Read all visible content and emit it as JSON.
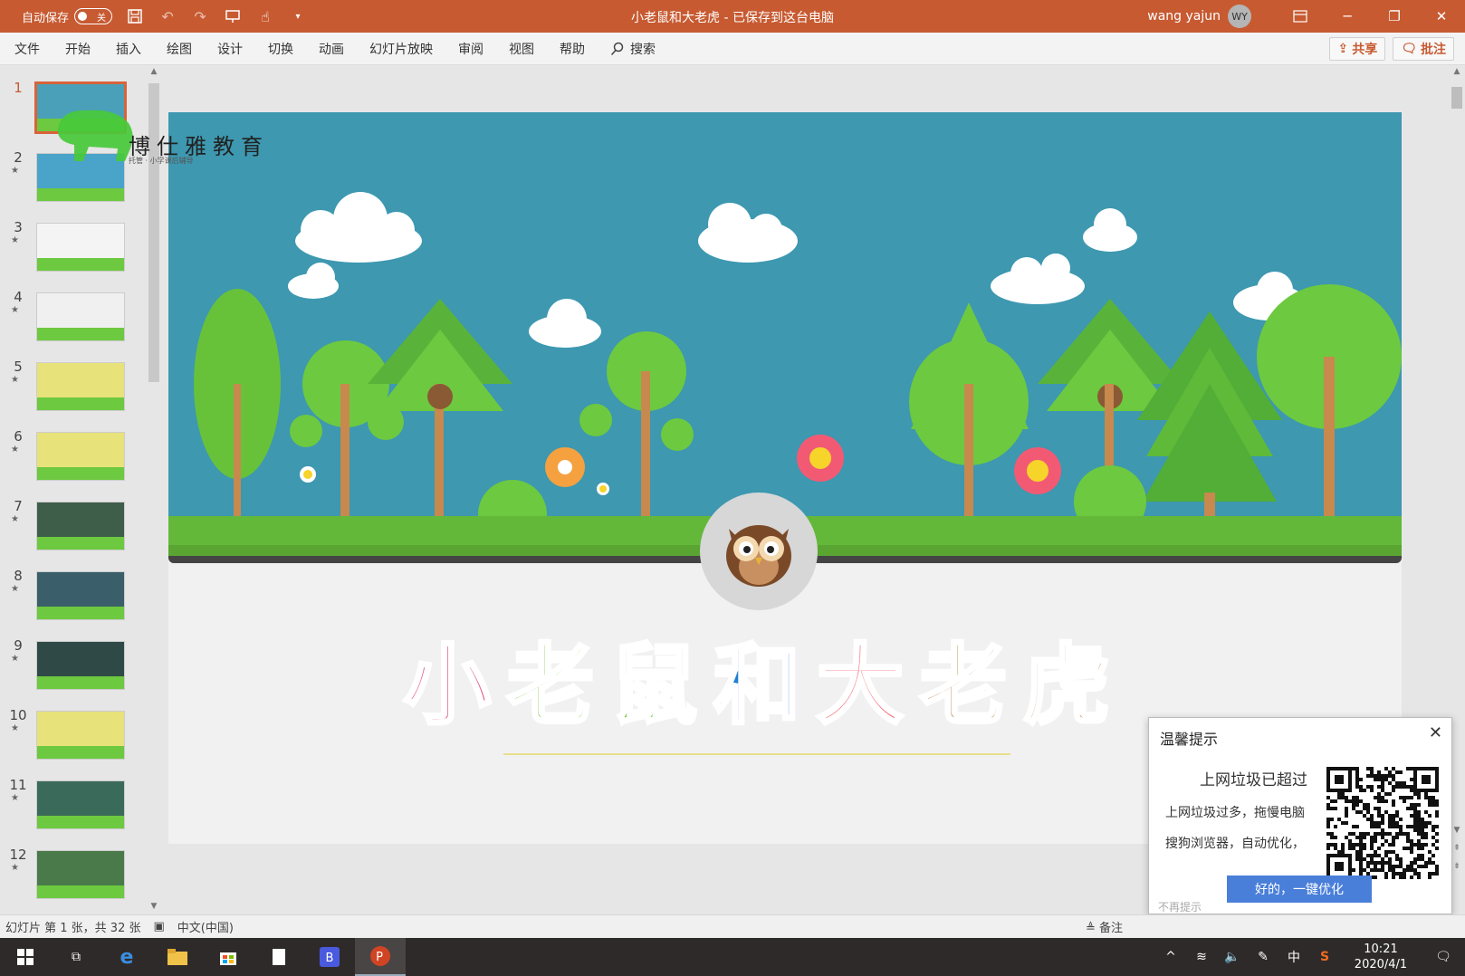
{
  "titlebar": {
    "autosave_label": "自动保存",
    "autosave_state": "关",
    "doc_title": "小老鼠和大老虎 - 已保存到这台电脑",
    "username": "wang yajun",
    "avatar_initials": "WY"
  },
  "menu": {
    "items": [
      "文件",
      "开始",
      "插入",
      "绘图",
      "设计",
      "切换",
      "动画",
      "幻灯片放映",
      "审阅",
      "视图",
      "帮助"
    ],
    "search_label": "搜索",
    "share_label": "共享",
    "comment_label": "批注"
  },
  "thumbnails": {
    "selected": 1,
    "items": [
      {
        "num": "1",
        "star": "",
        "color": "#4aa0b8"
      },
      {
        "num": "2",
        "star": "★",
        "color": "#4aa3c8"
      },
      {
        "num": "3",
        "star": "★",
        "color": "#f4f4f4"
      },
      {
        "num": "4",
        "star": "★",
        "color": "#f0f0f0"
      },
      {
        "num": "5",
        "star": "★",
        "color": "#e8e27a"
      },
      {
        "num": "6",
        "star": "★",
        "color": "#e8e27a"
      },
      {
        "num": "7",
        "star": "★",
        "color": "#3f5e4a"
      },
      {
        "num": "8",
        "star": "★",
        "color": "#3b5f6a"
      },
      {
        "num": "9",
        "star": "★",
        "color": "#2f4a46"
      },
      {
        "num": "10",
        "star": "★",
        "color": "#e8e27a"
      },
      {
        "num": "11",
        "star": "★",
        "color": "#3a6a5a"
      },
      {
        "num": "12",
        "star": "★",
        "color": "#4a7a4a"
      }
    ]
  },
  "slide": {
    "logo_text": "博仕雅教育",
    "logo_sub": "托管 · 小学课后辅导",
    "title_chars": [
      {
        "char": "小",
        "color": "#e05f8a"
      },
      {
        "char": "老",
        "color": "#7dc54a"
      },
      {
        "char": "鼠",
        "color": "#84c94b"
      },
      {
        "char": "和",
        "color": "#1f7fd4"
      },
      {
        "char": "大",
        "color": "#f36b78"
      },
      {
        "char": "老",
        "color": "#a86a2a"
      },
      {
        "char": "虎",
        "color": "#a86a2a"
      }
    ]
  },
  "statusbar": {
    "slide_info": "幻灯片 第 1 张，共 32 张",
    "language": "中文(中国)",
    "notes_label": "备注"
  },
  "popup": {
    "title": "温馨提示",
    "headline": "上网垃圾已超过",
    "line1": "上网垃圾过多，拖慢电脑",
    "line2": "搜狗浏览器，自动优化，",
    "button_label": "好的，一键优化",
    "footer": "不再提示"
  },
  "taskbar": {
    "time": "10:21",
    "date": "2020/4/1",
    "ime_label": "中"
  }
}
